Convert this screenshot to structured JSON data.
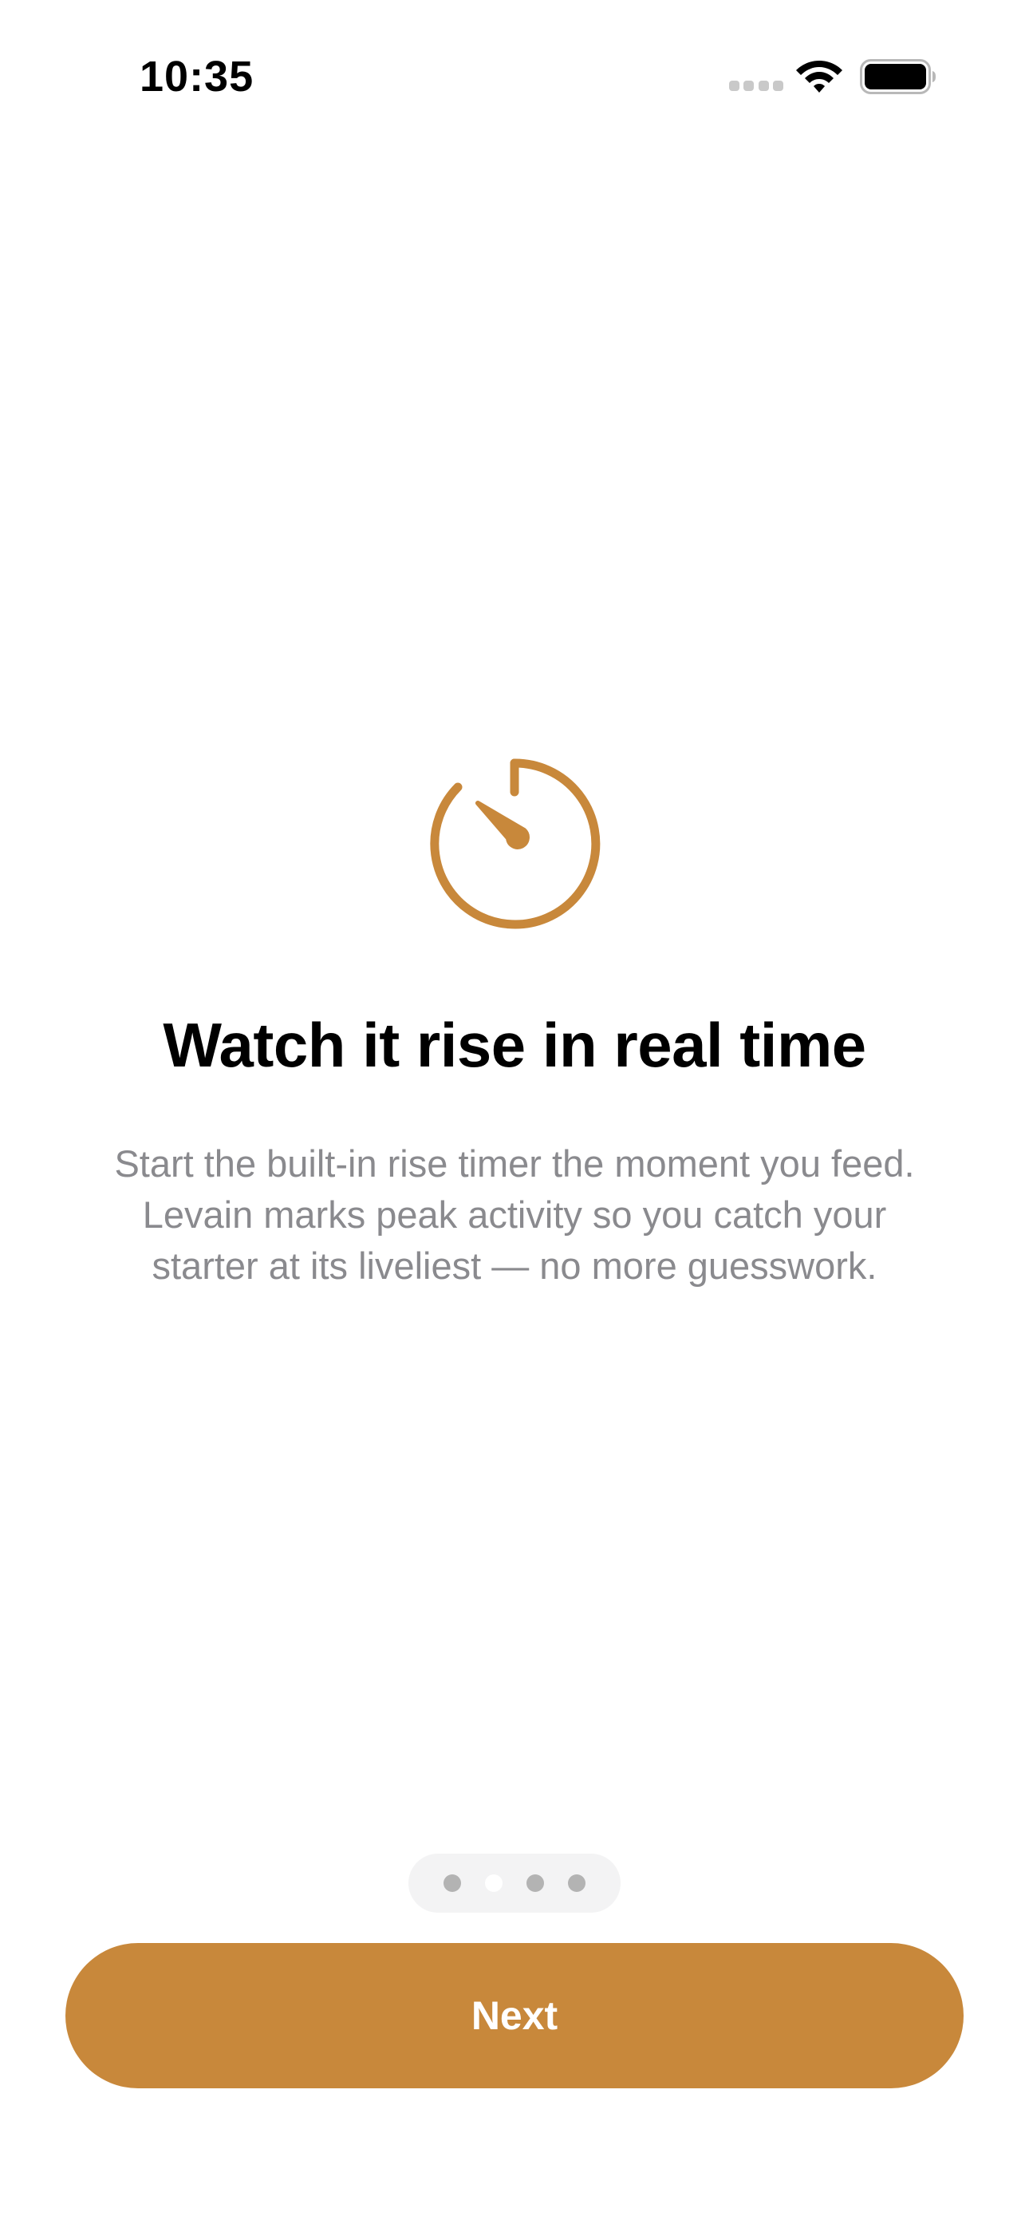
{
  "status_bar": {
    "time": "10:35",
    "icons": [
      "cellular-signal-icon",
      "wifi-icon",
      "battery-icon"
    ]
  },
  "onboarding": {
    "icon": "timer-icon",
    "title": "Watch it rise in real time",
    "description": "Start the built-in rise timer the moment you feed. Levain marks peak activity so you catch your starter at its liveliest — no more guesswork.",
    "page_indicator": {
      "total_pages": 4,
      "current_page": 2
    },
    "next_button_label": "Next"
  },
  "colors": {
    "accent": "#c8883b",
    "description_text": "#8a8a8e",
    "indicator_background": "#f3f3f4",
    "indicator_dot": "#b3b3b3",
    "indicator_dot_current": "#ffffff",
    "background": "#ffffff"
  }
}
